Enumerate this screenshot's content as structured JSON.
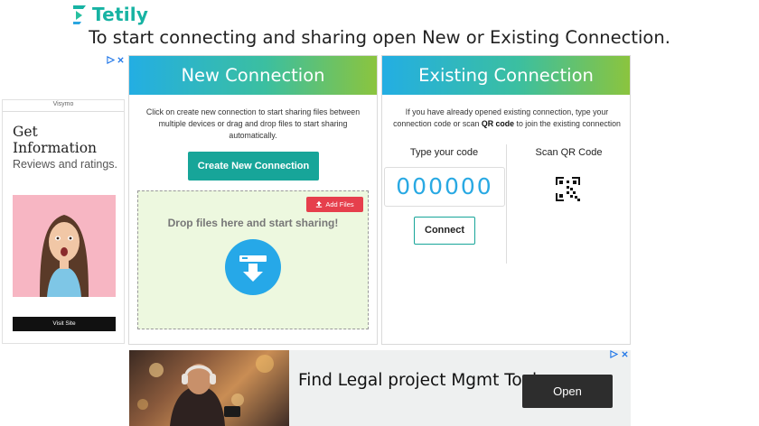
{
  "brand": {
    "name": "Tetily",
    "color": "#17b3a3"
  },
  "headline": "To start connecting and sharing open New or Existing Connection.",
  "left_ad": {
    "brand": "Visymo",
    "heading": "Get Information",
    "subheading": "Reviews and ratings.",
    "cta": "Visit Site"
  },
  "new_connection": {
    "title": "New Connection",
    "description": "Click on create new connection to start sharing files between multiple devices or drag and drop files to start sharing automatically.",
    "create_button": "Create New Connection",
    "add_files": "Add Files",
    "drop_text": "Drop files here and start sharing!"
  },
  "existing_connection": {
    "title": "Existing Connection",
    "description_part1": "If you have already opened existing connection, type your connection code or scan ",
    "description_bold": "QR code",
    "description_part2": " to join the existing connection",
    "type_code_label": "Type your code",
    "scan_label": "Scan QR Code",
    "code_placeholder": "000000",
    "connect_button": "Connect"
  },
  "bottom_ad": {
    "title": "Find Legal project Mgmt Tools",
    "cta": "Open"
  },
  "colors": {
    "accent": "#17a599",
    "banner_start": "#23aee3",
    "banner_end": "#8bc43e",
    "add_files": "#e63f4c",
    "drop_bg": "#edf8df",
    "code_text": "#29a9e3"
  }
}
